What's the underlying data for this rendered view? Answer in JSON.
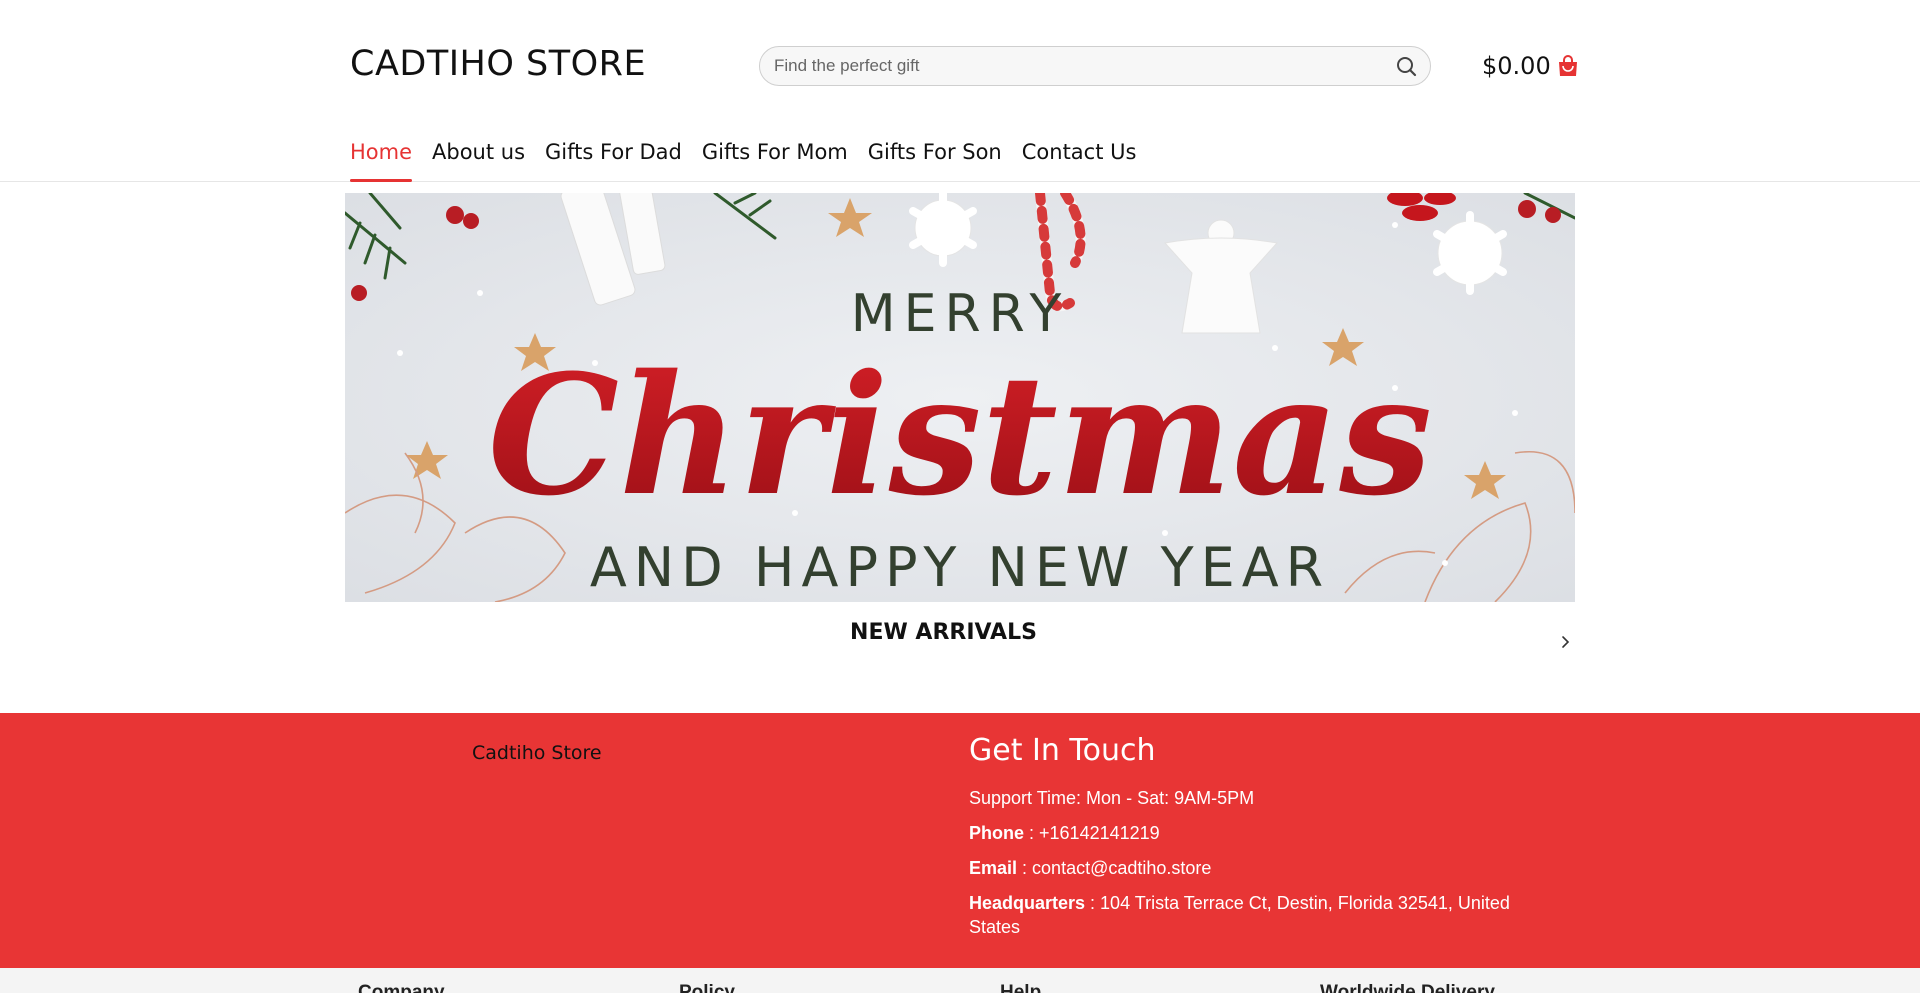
{
  "header": {
    "logo": "CADTIHO STORE",
    "search_placeholder": "Find the perfect gift",
    "search_icon": "search-icon",
    "cart_amount": "$0.00",
    "cart_icon": "shopping-bag-icon",
    "accent_color": "#e63333"
  },
  "nav": {
    "items": [
      {
        "label": "Home",
        "active": true
      },
      {
        "label": "About us"
      },
      {
        "label": "Gifts For Dad"
      },
      {
        "label": "Gifts For Mom"
      },
      {
        "label": "Gifts For Son"
      },
      {
        "label": "Contact Us"
      }
    ]
  },
  "banner": {
    "line1": "MERRY",
    "line2": "Christmas",
    "line3": "AND HAPPY NEW YEAR"
  },
  "arrivals": {
    "title": "NEW ARRIVALS",
    "next_icon": "chevron-right-icon"
  },
  "footer": {
    "background": "#e83535",
    "store_name": "Cadtiho Store",
    "touch_title": "Get In Touch",
    "support": "Support Time: Mon - Sat: 9AM-5PM",
    "phone_label": "Phone",
    "phone": " : +16142141219",
    "email_label": "Email",
    "email_sep": " : ",
    "email": "contact@cadtiho.store",
    "hq_label": "Headquarters",
    "hq": " : 104 Trista Terrace Ct, Destin, Florida 32541, United States"
  },
  "subfooter": {
    "columns": [
      "Company",
      "Policy",
      "Help",
      "Worldwide Delivery"
    ]
  }
}
